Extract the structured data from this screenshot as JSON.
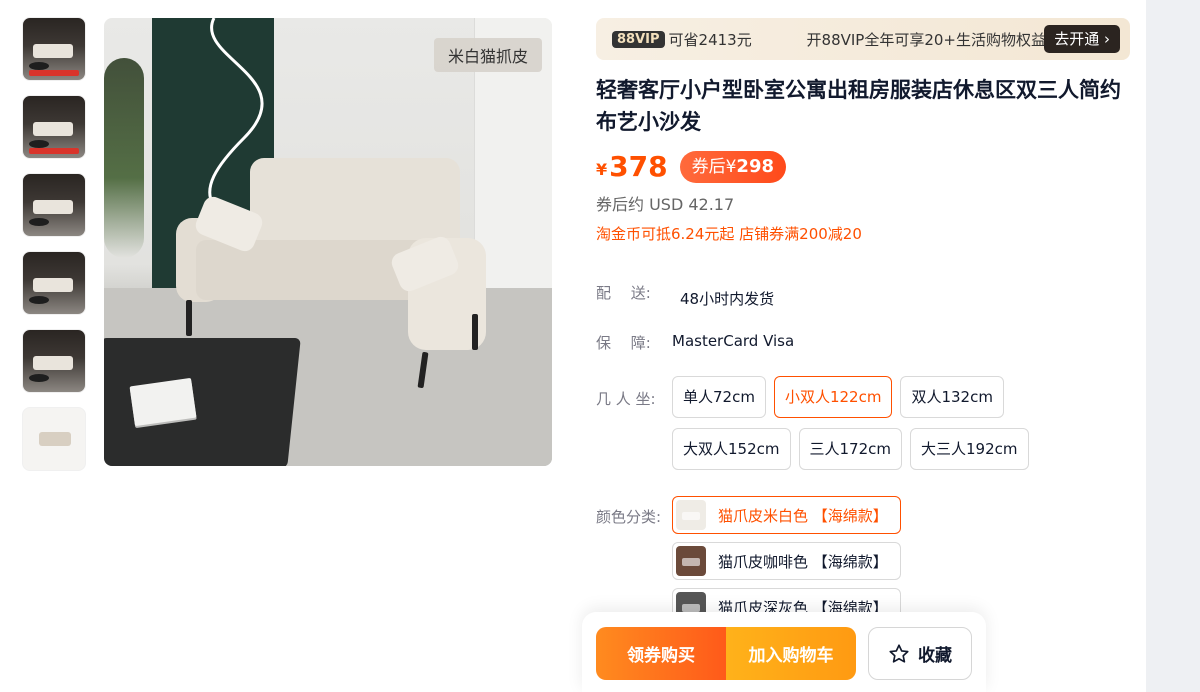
{
  "gallery": {
    "thumbnails": [
      "thumb-1",
      "thumb-2",
      "thumb-3",
      "thumb-4",
      "thumb-5",
      "thumb-6"
    ],
    "image_tag": "米白猫抓皮"
  },
  "vip": {
    "badge": "88VIP",
    "save": "可省2413元",
    "desc": "开88VIP全年可享20+生活购物权益，",
    "more": "⋮",
    "button": "去开通",
    "button_arrow": "›"
  },
  "product": {
    "title": "轻奢客厅小户型卧室公寓出租房服装店休息区双三人简约布艺小沙发",
    "currency": "¥",
    "price": "378",
    "coupon_label": "券后",
    "coupon_currency": "¥",
    "coupon_price": "298",
    "usd": "券后约 USD 42.17",
    "promo": "淘金币可抵6.24元起 店铺券满200减20"
  },
  "specs": {
    "shipping_label": "配　 送:",
    "shipping_value": "48小时内发货",
    "guarantee_label": "保　 障:",
    "guarantee_value": "MasterCard Visa",
    "seats_label": "几 人 坐:",
    "seats": [
      {
        "label": "单人72cm",
        "selected": false
      },
      {
        "label": "小双人122cm",
        "selected": true
      },
      {
        "label": "双人132cm",
        "selected": false
      },
      {
        "label": "大双人152cm",
        "selected": false
      },
      {
        "label": "三人172cm",
        "selected": false
      },
      {
        "label": "大三人192cm",
        "selected": false
      }
    ],
    "color_label": "颜色分类:",
    "colors": [
      {
        "label": "猫爪皮米白色 【海绵款】",
        "selected": true,
        "swatch": "#efece6"
      },
      {
        "label": "猫爪皮咖啡色 【海绵款】",
        "selected": false,
        "swatch": "#6b4a3a"
      },
      {
        "label": "猫爪皮深灰色 【海绵款】",
        "selected": false,
        "swatch": "#565656"
      }
    ]
  },
  "actions": {
    "coupon_buy": "领券购买",
    "add_cart": "加入购物车",
    "favorite": "收藏",
    "favorite_icon": "star-icon"
  },
  "colors": {
    "accent": "#ff5000",
    "text": "#11192d",
    "muted": "#7a7a86"
  }
}
